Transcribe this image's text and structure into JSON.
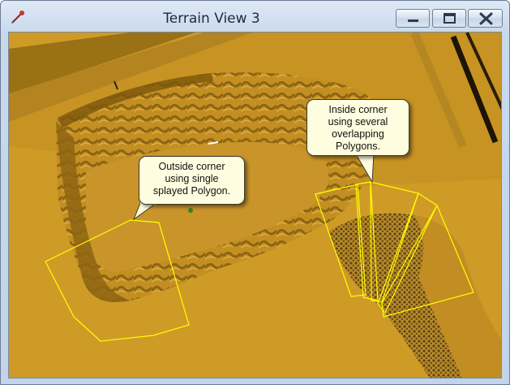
{
  "window": {
    "title": "Terrain View 3",
    "app_icon": "terrain-pick-icon",
    "controls": {
      "minimize": "minimize-icon",
      "maximize": "maximize-icon",
      "close": "close-icon"
    }
  },
  "viewport": {
    "background_color": "#cf9b27",
    "polygon_color": "#ffff00",
    "callouts": [
      {
        "text": "Outside corner\nusing single\nsplayed Polygon."
      },
      {
        "text": "Inside corner\nusing several\noverlapping\nPolygons."
      }
    ]
  }
}
